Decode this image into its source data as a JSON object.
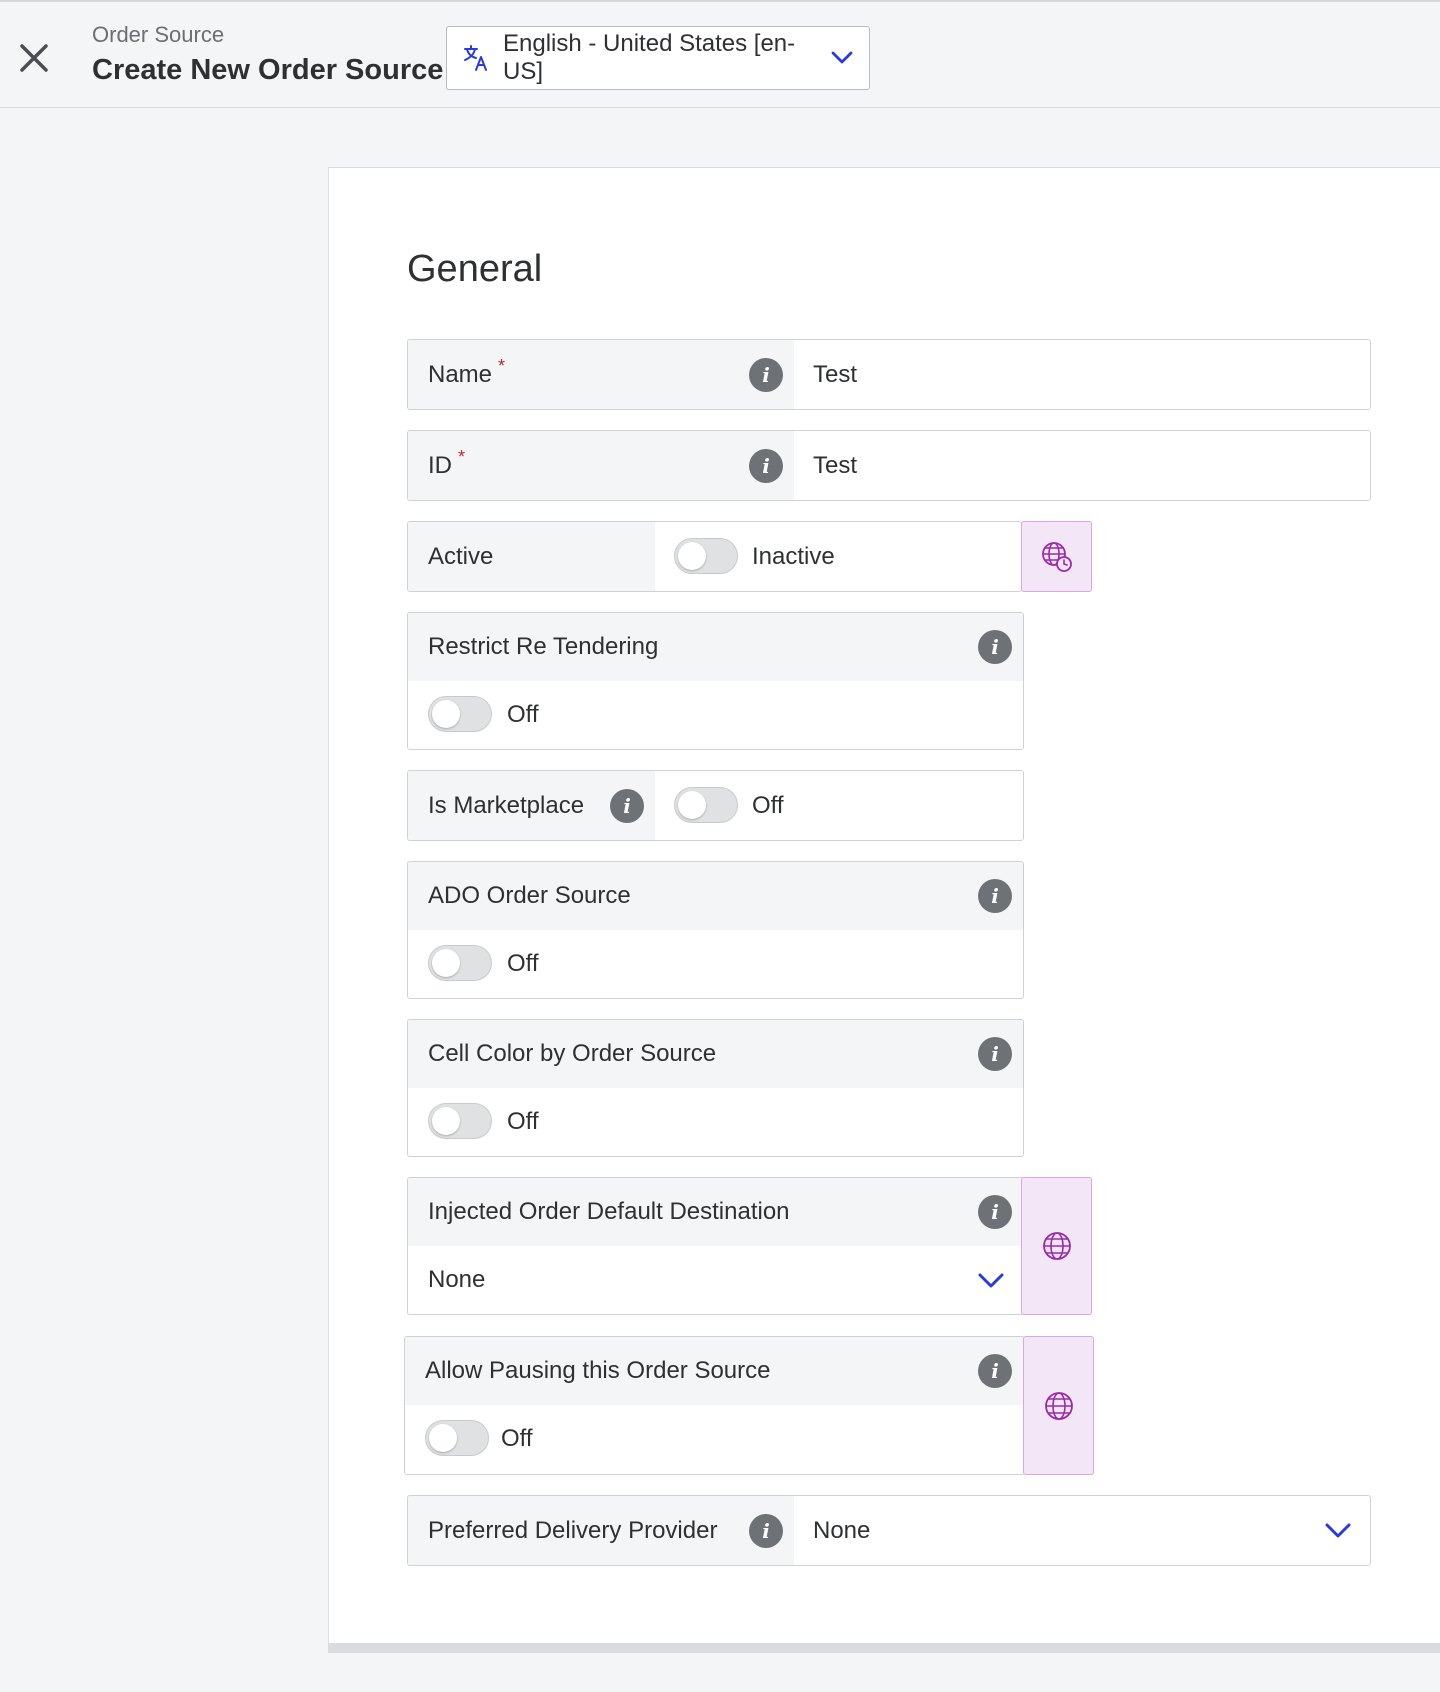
{
  "header": {
    "breadcrumb": "Order Source",
    "title": "Create New Order Source",
    "locale": "English - United States [en-US]",
    "icons": {
      "close": "close-icon",
      "translate": "translate-icon",
      "chevron": "chevron-down-icon"
    }
  },
  "section": {
    "title": "General"
  },
  "fields": {
    "name": {
      "label": "Name",
      "required_mark": "*",
      "value": "Test"
    },
    "id": {
      "label": "ID",
      "required_mark": "*",
      "value": "Test"
    },
    "active": {
      "label": "Active",
      "state": "Inactive"
    },
    "restrict_re_tendering": {
      "label": "Restrict Re Tendering",
      "state": "Off"
    },
    "is_marketplace": {
      "label": "Is Marketplace",
      "state": "Off"
    },
    "ado_order_source": {
      "label": "ADO Order Source",
      "state": "Off"
    },
    "cell_color": {
      "label": "Cell Color by Order Source",
      "state": "Off"
    },
    "injected_default_destination": {
      "label": "Injected Order Default Destination",
      "value": "None"
    },
    "allow_pausing": {
      "label": "Allow Pausing this Order Source",
      "state": "Off"
    },
    "preferred_delivery_provider": {
      "label": "Preferred Delivery Provider",
      "value": "None"
    }
  },
  "colors": {
    "accent": "#2b3bd6",
    "globe": "#9b2aa8",
    "required": "#c4262e"
  }
}
